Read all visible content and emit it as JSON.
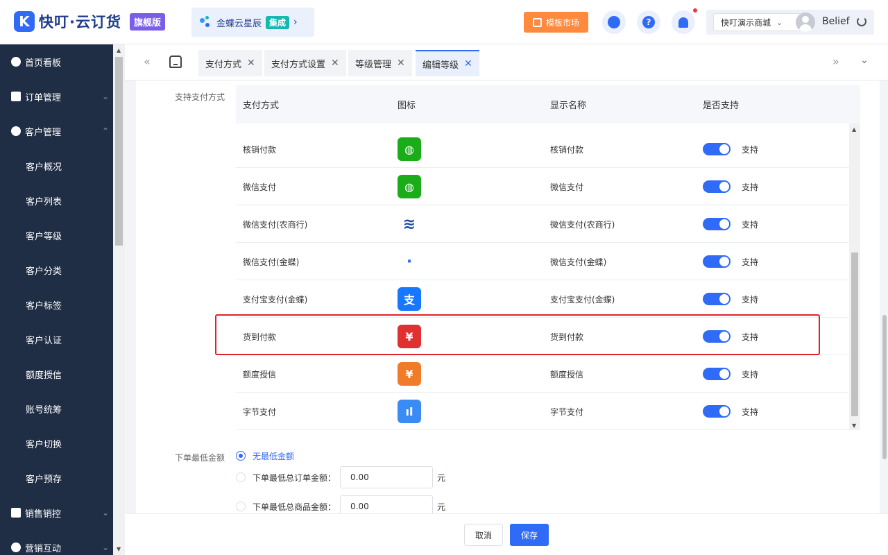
{
  "header": {
    "logo_mark": "K",
    "logo_text": "快叮·云订货",
    "edition_badge": "旗舰版",
    "partner_name": "金蝶云星辰",
    "partner_tag": "集成",
    "partner_chevron": "›",
    "template_market": "模板市场",
    "help_glyph": "?",
    "store_name": "快叮演示商城",
    "store_chevron": "⌄",
    "username": "Belief"
  },
  "sidebar": {
    "groups": [
      {
        "label": "首页看板"
      },
      {
        "label": "订单管理",
        "arrow": "⌄"
      },
      {
        "label": "客户管理",
        "arrow": "⌃"
      },
      {
        "label": "销售销控",
        "arrow": "⌄"
      },
      {
        "label": "营销互动",
        "arrow": "⌄"
      }
    ],
    "sub_items": [
      "客户概况",
      "客户列表",
      "客户等级",
      "客户分类",
      "客户标签",
      "客户认证",
      "额度授信",
      "账号统筹",
      "客户切换",
      "客户预存"
    ],
    "scroll_up": "▲",
    "scroll_down": "▼"
  },
  "tabs": {
    "nav_left": "«",
    "nav_right": "»",
    "dropdown": "⌄",
    "close_glyph": "✕",
    "items": [
      {
        "label": "支付方式"
      },
      {
        "label": "支付方式设置"
      },
      {
        "label": "等级管理"
      },
      {
        "label": "编辑等级"
      }
    ]
  },
  "payment_section": {
    "label": "支持支付方式",
    "columns": [
      "支付方式",
      "图标",
      "显示名称",
      "是否支持"
    ],
    "support_label": "支持",
    "rows": [
      {
        "method": "核销付款",
        "icon": "wechat-icon",
        "icon_color": "#1aad19",
        "display_name": "核销付款",
        "supported": true
      },
      {
        "method": "微信支付",
        "icon": "wechat-icon",
        "icon_color": "#1aad19",
        "display_name": "微信支付",
        "supported": true
      },
      {
        "method": "微信支付(农商行)",
        "icon": "rural-bank-icon",
        "icon_color": "#1e4fa3",
        "display_name": "微信支付(农商行)",
        "supported": true
      },
      {
        "method": "微信支付(金蝶)",
        "icon": "kingdee-icon",
        "icon_color": "#2f6bf6",
        "display_name": "微信支付(金蝶)",
        "supported": true
      },
      {
        "method": "支付宝支付(金蝶)",
        "icon": "alipay-icon",
        "icon_color": "#1677ff",
        "display_name": "支付宝支付(金蝶)",
        "supported": true
      },
      {
        "method": "货到付款",
        "icon": "cash-on-delivery-icon",
        "icon_color": "#e03131",
        "display_name": "货到付款",
        "supported": true
      },
      {
        "method": "额度授信",
        "icon": "credit-icon",
        "icon_color": "#f07c2a",
        "display_name": "额度授信",
        "supported": true
      },
      {
        "method": "字节支付",
        "icon": "bytedance-pay-icon",
        "icon_color": "#3b8bf5",
        "display_name": "字节支付",
        "supported": true
      }
    ],
    "icon_glyphs": {
      "wechat-icon": "◍",
      "rural-bank-icon": "≋",
      "kingdee-icon": "·",
      "alipay-icon": "支",
      "cash-on-delivery-icon": "¥",
      "credit-icon": "¥",
      "bytedance-pay-icon": "ıl"
    },
    "scroll_up": "▲",
    "scroll_down": "▼"
  },
  "min_order": {
    "label": "下单最低金额",
    "options": [
      {
        "label": "无最低金额",
        "selected": true
      },
      {
        "label": "下单最低总订单金额：",
        "value": "0.00",
        "unit": "元",
        "selected": false
      },
      {
        "label": "下单最低总商品金额：",
        "value": "0.00",
        "unit": "元",
        "selected": false
      }
    ]
  },
  "footer": {
    "cancel": "取消",
    "save": "保存"
  },
  "colors": {
    "primary": "#2f6bf6",
    "sidebar_bg": "#1f2d45",
    "highlight_border": "#e0202a",
    "market_orange": "#ff8a3d",
    "edition_purple": "#7b5ee8"
  }
}
